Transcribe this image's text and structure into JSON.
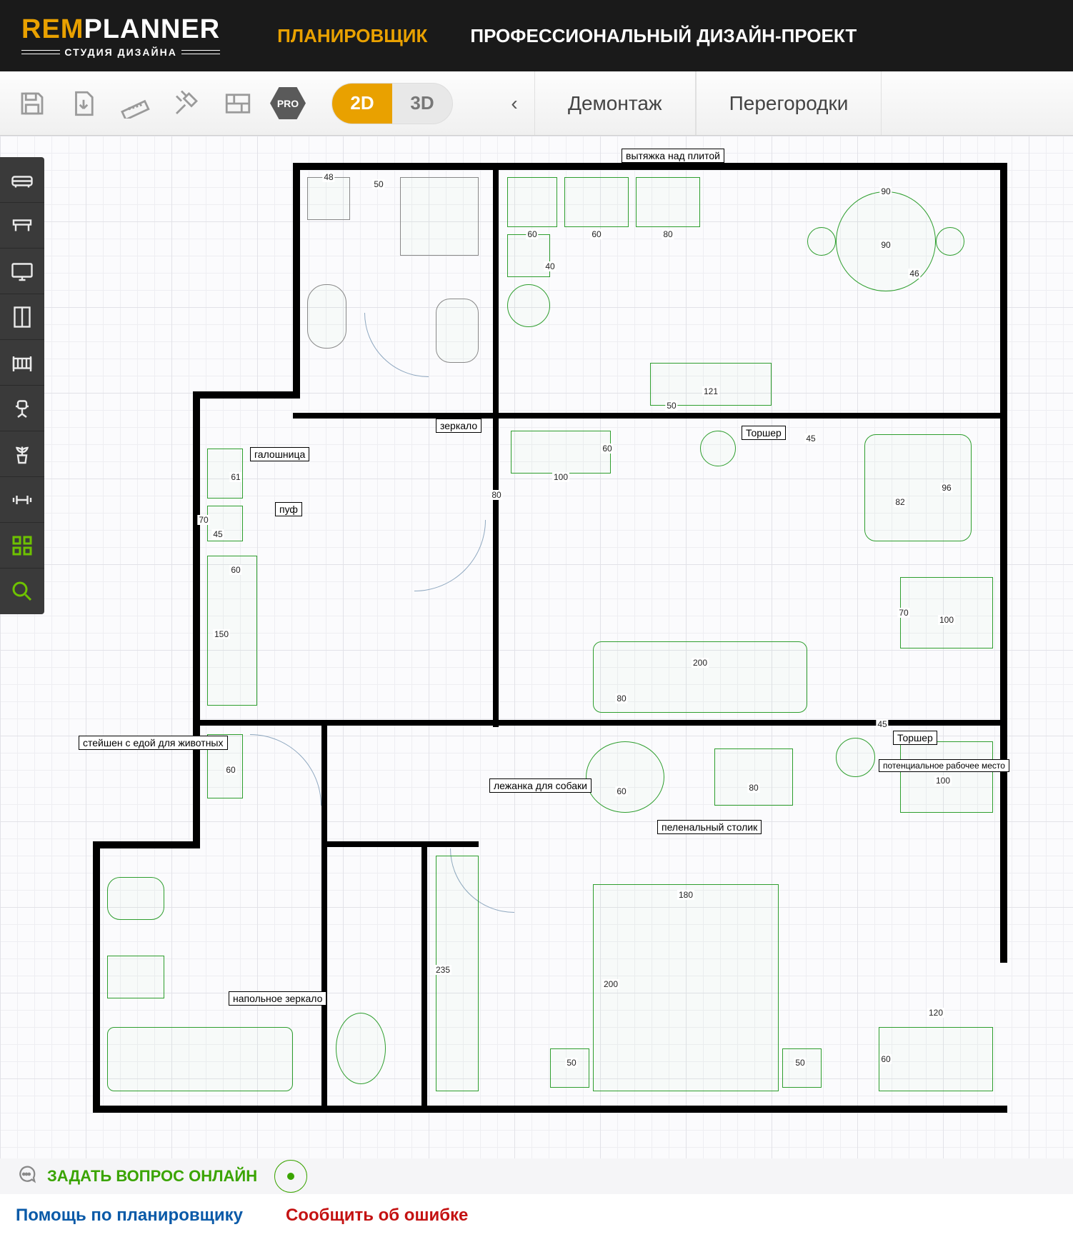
{
  "brand": {
    "prefix": "REM",
    "suffix": "PLANNER",
    "tagline": "СТУДИЯ ДИЗАЙНА"
  },
  "nav": {
    "planner": "ПЛАНИРОВЩИК",
    "pro_project": "ПРОФЕССИОНАЛЬНЫЙ ДИЗАЙН-ПРОЕКТ"
  },
  "toolbar": {
    "pro": "PRO",
    "view2d": "2D",
    "view3d": "3D",
    "tabs": {
      "prev": "‹",
      "demolition": "Демонтаж",
      "partitions": "Перегородки"
    }
  },
  "palette_icons": [
    "sofa",
    "table",
    "monitor",
    "wardrobe",
    "crib",
    "office-chair",
    "plant",
    "dumbbell",
    "grid",
    "search"
  ],
  "annotations": {
    "hood": "вытяжка над плитой",
    "mirror": "зеркало",
    "shoe_rack": "галошница",
    "pouf": "пуф",
    "torchere1": "Торшер",
    "torchere2": "Торшер",
    "pet_station": "стейшен с едой для животных",
    "dog_bed": "лежанка для собаки",
    "changing_table": "пеленальный столик",
    "workspace": "потенциальное рабочее место",
    "floor_mirror": "напольное зеркало"
  },
  "dims": {
    "d48": "48",
    "d50": "50",
    "d60": "60",
    "d60b": "60",
    "d60c": "60",
    "d80": "80",
    "d80b": "80",
    "d80c": "80",
    "d90": "90",
    "d90b": "90",
    "d46": "46",
    "d40": "40",
    "d121": "121",
    "d100": "100",
    "d100b": "100",
    "d100c": "100",
    "d82": "82",
    "d96": "96",
    "d200": "200",
    "d200b": "200",
    "d70": "70",
    "d70b": "70",
    "d45": "45",
    "d45b": "45",
    "d45c": "45",
    "d61": "61",
    "d150": "150",
    "d235": "235",
    "d180": "180",
    "d120": "120",
    "d50b": "50",
    "d50c": "50",
    "d50d": "50",
    "d60d": "60",
    "d60e": "60",
    "d60f": "60",
    "d80d": "80"
  },
  "chat": {
    "label": "ЗАДАТЬ ВОПРОС ОНЛАЙН"
  },
  "footer": {
    "help": "Помощь по планировщику",
    "report": "Сообщить об ошибке"
  }
}
